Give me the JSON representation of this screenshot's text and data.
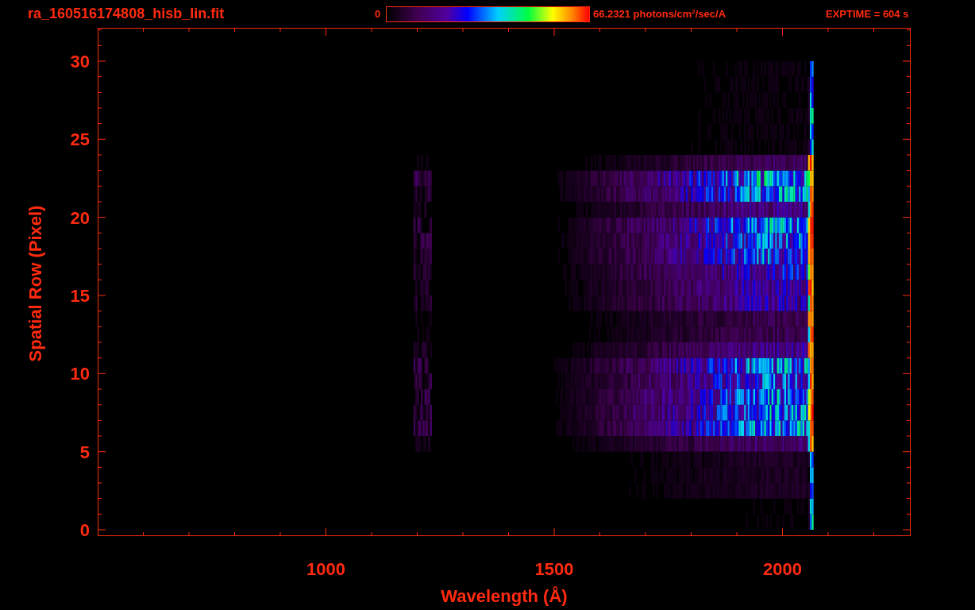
{
  "header": {
    "filename": "ra_160516174808_hisb_lin.fit",
    "colorbar": {
      "min_label": "0",
      "max_label": "66.2321 photons/cm$^{2}$/sec/A"
    },
    "exposure": "EXPTIME = 604 s"
  },
  "plot": {
    "x_axis": {
      "title": "Wavelength (Å)",
      "tick_labels": [
        "1000",
        "1500",
        "2000"
      ]
    },
    "y_axis": {
      "title": "Spatial Row (Pixel)",
      "tick_labels": [
        "30",
        "25",
        "20",
        "15",
        "10",
        "5",
        "0"
      ]
    }
  }
}
